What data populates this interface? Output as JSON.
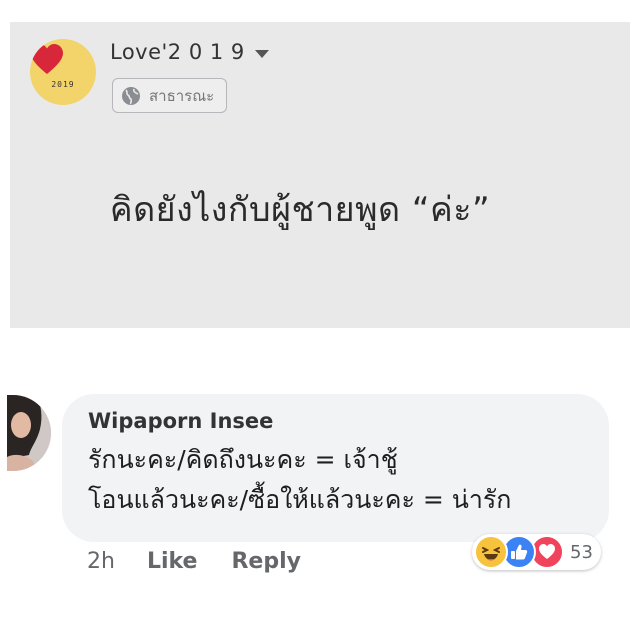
{
  "post": {
    "author": "Love'2 0 1 9",
    "avatar_text": "2019",
    "privacy": "สาธารณะ",
    "text": "คิดยังไงกับผู้ชายพูด “ค่ะ”"
  },
  "comment": {
    "author": "Wipaporn Insee",
    "lines": [
      "รักนะคะ/คิดถึงนะคะ = เจ้าชู้",
      "โอนแล้วนะคะ/ซื้อให้แล้วนะคะ =  น่ารัก"
    ],
    "time": "2h",
    "like_label": "Like",
    "reply_label": "Reply",
    "reactions": {
      "icons": [
        "haha-icon",
        "like-icon",
        "love-icon"
      ],
      "count": "53"
    }
  },
  "colors": {
    "post_background": "#e9e9ea",
    "bubble_background": "#f2f3f5",
    "like_blue": "#3b82f5",
    "love_red": "#f0435c",
    "haha_yellow": "#f7c23c"
  }
}
